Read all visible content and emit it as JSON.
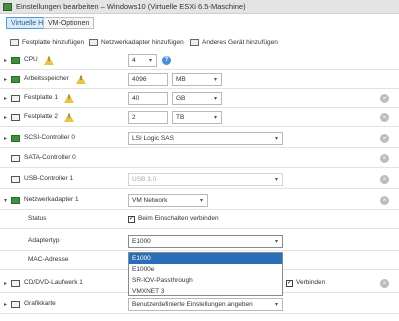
{
  "window": {
    "title": "Einstellungen bearbeiten – Windows10 (Virtuelle ESXi 6.5-Maschine)"
  },
  "tabs": [
    {
      "label": "Virtuelle Hardware",
      "active": true
    },
    {
      "label": "VM-Optionen",
      "active": false
    }
  ],
  "toolbar": {
    "add_disk": "Festplatte hinzufügen",
    "add_nic": "Netzwerkadapter hinzufügen",
    "add_other": "Anderes Gerät hinzufügen"
  },
  "rows": {
    "cpu": {
      "label": "CPU",
      "value": "4"
    },
    "memory": {
      "label": "Arbeitsspeicher",
      "value": "4096",
      "unit": "MB"
    },
    "disk1": {
      "label": "Festplatte 1",
      "value": "40",
      "unit": "GB"
    },
    "disk2": {
      "label": "Festplatte 2",
      "value": "2",
      "unit": "TB"
    },
    "scsi": {
      "label": "SCSI-Controller 0",
      "value": "LSI Logic SAS"
    },
    "sata": {
      "label": "SATA-Controller 0"
    },
    "usb": {
      "label": "USB-Controller 1",
      "value": "USB 3.0"
    },
    "nic": {
      "label": "Netzwerkadapter 1",
      "value": "VM Network"
    },
    "status": {
      "label": "Status",
      "checkbox_label": "Beim Einschalten verbinden",
      "checked": true
    },
    "adapter_type": {
      "label": "Adaptertyp",
      "value": "E1000"
    },
    "mac": {
      "label": "MAC-Adresse"
    },
    "cdrom": {
      "label": "CD/DVD-Laufwerk 1",
      "checkbox_label": "Verbinden"
    },
    "graphics": {
      "label": "Grafikkarte",
      "value": "Benutzerdefinierte Einstellungen angeben"
    }
  },
  "adapter_options": [
    "E1000",
    "E1000e",
    "SR-IOV-Passthrough",
    "VMXNET 3"
  ],
  "adapter_selected_index": 0,
  "colors": {
    "accent": "#4f9bd6",
    "selection": "#2b6eb8",
    "warning": "#e8c547"
  }
}
